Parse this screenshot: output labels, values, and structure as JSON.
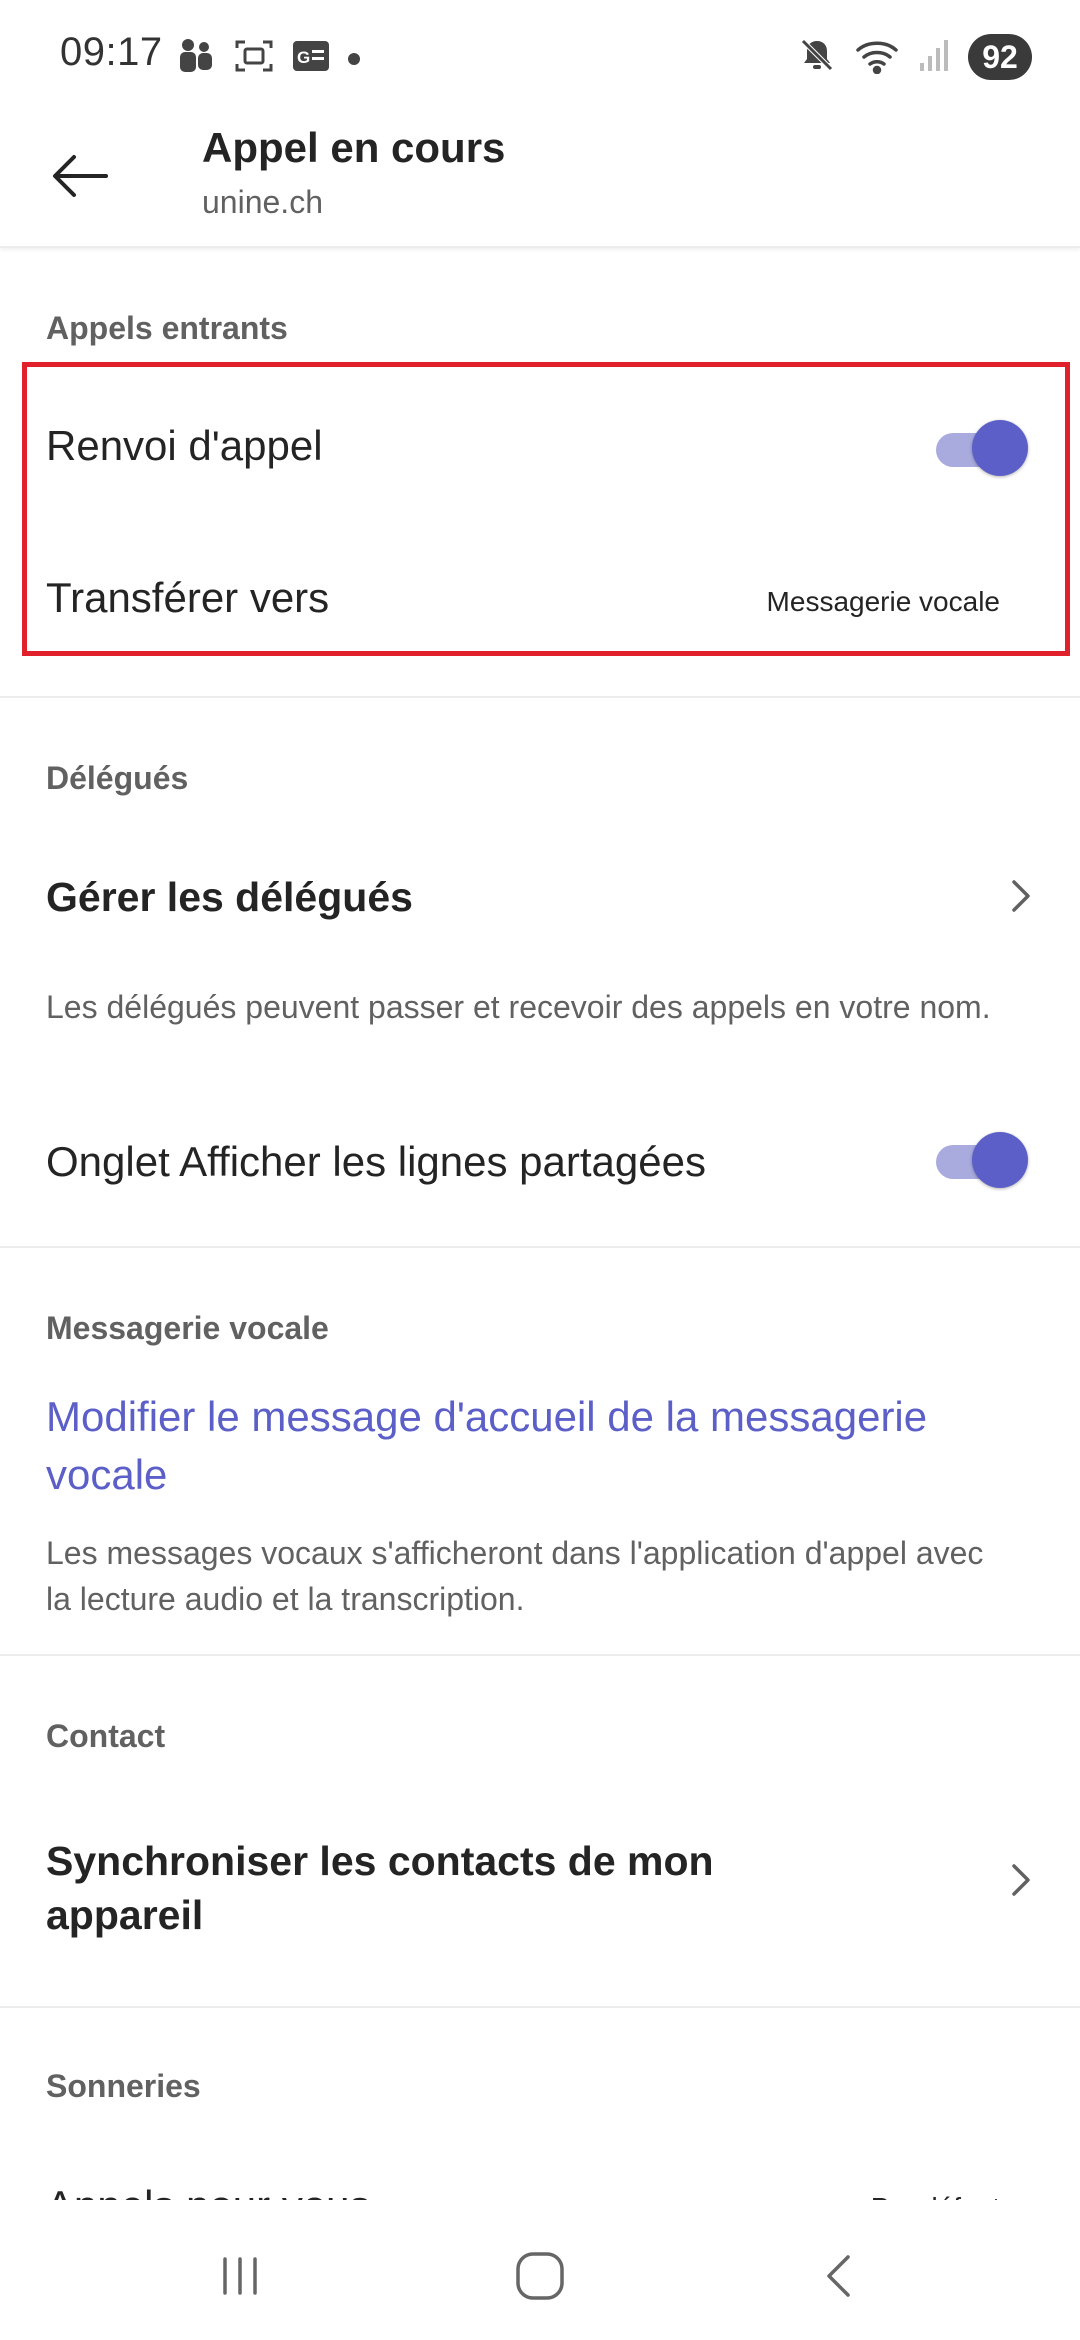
{
  "status_bar": {
    "time": "09:17",
    "battery": "92",
    "icons": [
      "teams-icon",
      "screenshot-icon",
      "gallery-icon",
      "notification-dot",
      "mute-icon",
      "wifi-icon",
      "signal-icon"
    ]
  },
  "header": {
    "title": "Appel en cours",
    "subtitle": "unine.ch"
  },
  "sections": {
    "incoming": {
      "header": "Appels entrants",
      "forwarding_label": "Renvoi d'appel",
      "forwarding_on": true,
      "transfer_label": "Transférer vers",
      "transfer_value": "Messagerie vocale"
    },
    "delegates": {
      "header": "Délégués",
      "manage_label": "Gérer les délégués",
      "description": "Les délégués peuvent passer et recevoir des appels en votre nom.",
      "shared_lines_label": "Onglet Afficher les lignes partagées",
      "shared_lines_on": true
    },
    "voicemail": {
      "header": "Messagerie vocale",
      "greeting_link": "Modifier le message d'accueil de la messagerie vocale",
      "description": "Les messages vocaux s'afficheront dans l'application d'appel avec la lecture audio et la transcription."
    },
    "contact": {
      "header": "Contact",
      "sync_label": "Synchroniser les contacts de mon appareil"
    },
    "ringtones": {
      "header": "Sonneries",
      "calls_label": "Appels pour vous",
      "calls_value": "Par défaut"
    }
  },
  "colors": {
    "accent": "#5b5fc7",
    "toggle_track": "#a9abdf",
    "highlight": "#e0202a",
    "secondary_text": "#616161"
  }
}
